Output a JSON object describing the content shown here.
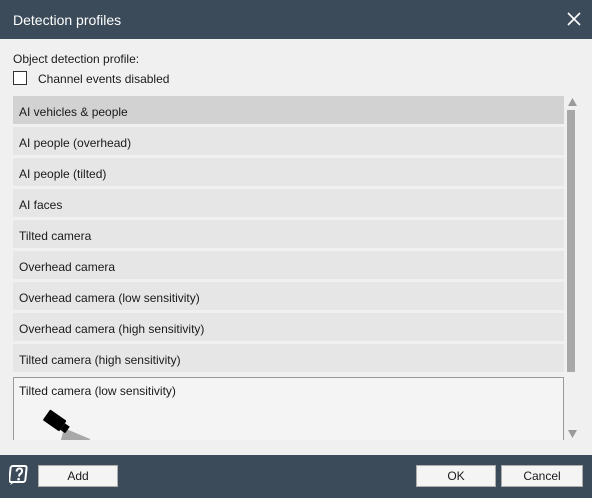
{
  "window": {
    "title": "Detection profiles"
  },
  "profile_section": {
    "label": "Object detection profile:",
    "channel_events_disabled": {
      "label": "Channel events disabled",
      "checked": false
    }
  },
  "profiles": [
    {
      "label": "AI vehicles & people",
      "state": "selected"
    },
    {
      "label": "AI people (overhead)",
      "state": "normal"
    },
    {
      "label": "AI people (tilted)",
      "state": "normal"
    },
    {
      "label": "AI faces",
      "state": "normal"
    },
    {
      "label": "Tilted camera",
      "state": "normal"
    },
    {
      "label": "Overhead camera",
      "state": "normal"
    },
    {
      "label": "Overhead camera (low sensitivity)",
      "state": "normal"
    },
    {
      "label": "Overhead camera (high sensitivity)",
      "state": "normal"
    },
    {
      "label": "Tilted camera (high sensitivity)",
      "state": "normal"
    },
    {
      "label": "Tilted camera (low sensitivity)",
      "state": "expanded",
      "icon": "tilted-camera-icon"
    }
  ],
  "footer": {
    "add_label": "Add",
    "ok_label": "OK",
    "cancel_label": "Cancel",
    "help_icon": "help-icon"
  },
  "colors": {
    "header_bg": "#3b4b5a",
    "item_bg": "#e6e6e6",
    "item_selected_bg": "#d2d2d2"
  }
}
